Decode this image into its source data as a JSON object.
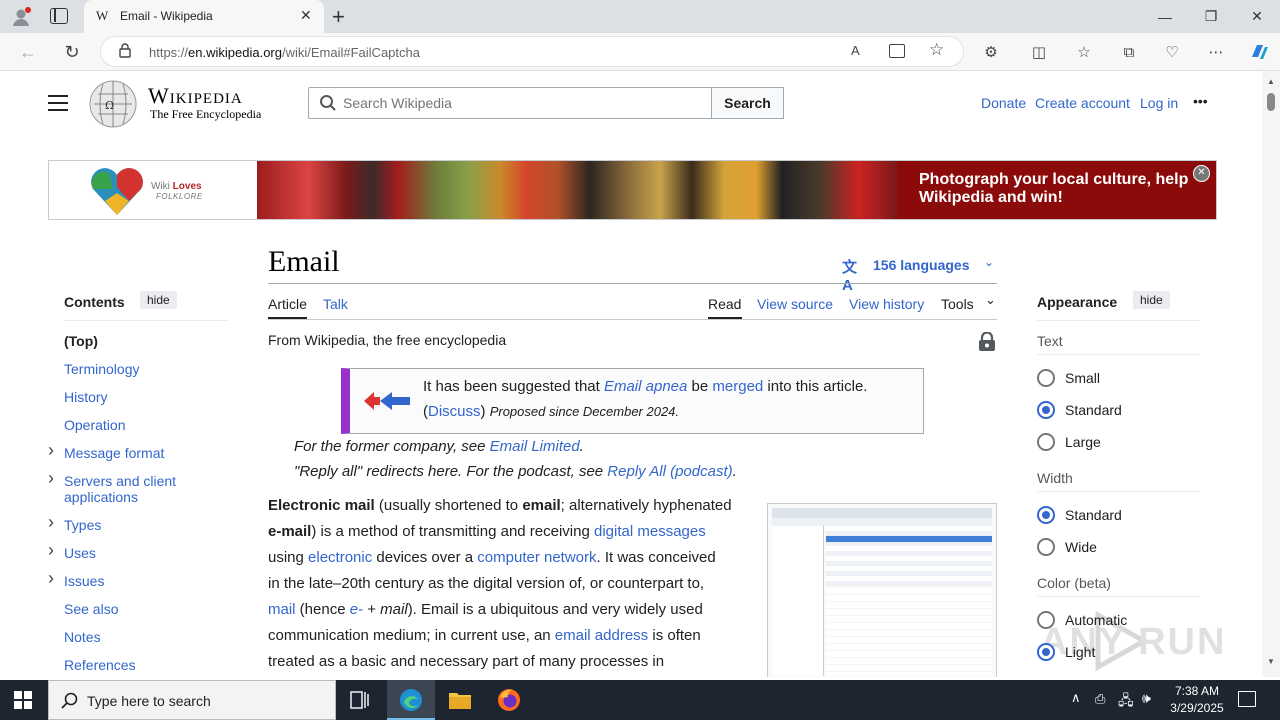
{
  "browser": {
    "tab_title": "Email - Wikipedia",
    "tab_favicon": "W",
    "url_prefix": "https://",
    "url_host": "en.wikipedia.org",
    "url_path": "/wiki/Email#FailCaptcha"
  },
  "header": {
    "wordmark": "Wikipedia",
    "tagline": "The Free Encyclopedia",
    "search_placeholder": "Search Wikipedia",
    "search_button": "Search",
    "links": [
      "Donate",
      "Create account",
      "Log in"
    ],
    "more": "•••"
  },
  "banner": {
    "logo_line1_a": "Wiki",
    "logo_line1_b": "Loves",
    "logo_line2": "FOLKLORE",
    "text_line1": "Photograph your local culture, help",
    "text_line2": "Wikipedia and win!",
    "close": "✕",
    "bg_color": "#8b0b0b"
  },
  "toc": {
    "title": "Contents",
    "hide": "hide",
    "items": [
      {
        "label": "(Top)",
        "bold": true,
        "expandable": false
      },
      {
        "label": "Terminology",
        "expandable": false
      },
      {
        "label": "History",
        "expandable": false
      },
      {
        "label": "Operation",
        "expandable": false
      },
      {
        "label": "Message format",
        "expandable": true
      },
      {
        "label": "Servers and client",
        "label2": "applications",
        "expandable": true
      },
      {
        "label": "Types",
        "expandable": true
      },
      {
        "label": "Uses",
        "expandable": true
      },
      {
        "label": "Issues",
        "expandable": true
      },
      {
        "label": "See also",
        "expandable": false
      },
      {
        "label": "Notes",
        "expandable": false
      },
      {
        "label": "References",
        "expandable": false
      }
    ]
  },
  "article": {
    "title": "Email",
    "languages": "156 languages",
    "tabs_left": [
      "Article",
      "Talk"
    ],
    "tabs_right": [
      "Read",
      "View source",
      "View history",
      "Tools"
    ],
    "from": "From Wikipedia, the free encyclopedia",
    "merge_notice": {
      "p1": "It has been suggested that ",
      "link1": "Email apnea",
      "p2": " be ",
      "link2": "merged",
      "p3": " into this article.",
      "paren_open": "(",
      "discuss": "Discuss",
      "paren_close": ")",
      "proposed": "Proposed since December 2024."
    },
    "hatnote1": {
      "text": "For the former company, see ",
      "link": "Email Limited",
      "end": "."
    },
    "hatnote2": {
      "text": "\"Reply all\" redirects here. For the podcast, see ",
      "link": "Reply All (podcast)",
      "end": "."
    },
    "lead": [
      {
        "b1": "Electronic mail",
        "t1": " (usually shortened to ",
        "b2": "email",
        "t2": "; alternatively hyphenated"
      },
      {
        "b1": "e-mail",
        "t1": ") is a method of transmitting and receiving ",
        "l1": "digital messages"
      },
      {
        "t1": "using ",
        "l1": "electronic",
        "t2": " devices over a ",
        "l2": "computer network",
        "t3": ". It was conceived"
      },
      {
        "t1": "in the late–20th century as the digital version of, or counterpart to,"
      },
      {
        "l1": "mail",
        "t1": " (hence ",
        "l2": "e-",
        "t2": " + ",
        "i1": "mail",
        "t3": "). Email is a ubiquitous and very widely used"
      },
      {
        "t1": "communication medium; in current use, an ",
        "l1": "email address",
        "t2": " is often"
      },
      {
        "t1": "treated as a basic and necessary part of many processes in"
      }
    ]
  },
  "appearance": {
    "title": "Appearance",
    "hide": "hide",
    "text_label": "Text",
    "text_options": [
      {
        "label": "Small",
        "selected": false
      },
      {
        "label": "Standard",
        "selected": true
      },
      {
        "label": "Large",
        "selected": false
      }
    ],
    "width_label": "Width",
    "width_options": [
      {
        "label": "Standard",
        "selected": true
      },
      {
        "label": "Wide",
        "selected": false
      }
    ],
    "color_label": "Color (beta)",
    "color_options": [
      {
        "label": "Automatic",
        "selected": false
      },
      {
        "label": "Light",
        "selected": true
      }
    ]
  },
  "taskbar": {
    "search_placeholder": "Type here to search",
    "time": "7:38 AM",
    "date": "3/29/2025"
  },
  "watermark": "ANY RUN"
}
